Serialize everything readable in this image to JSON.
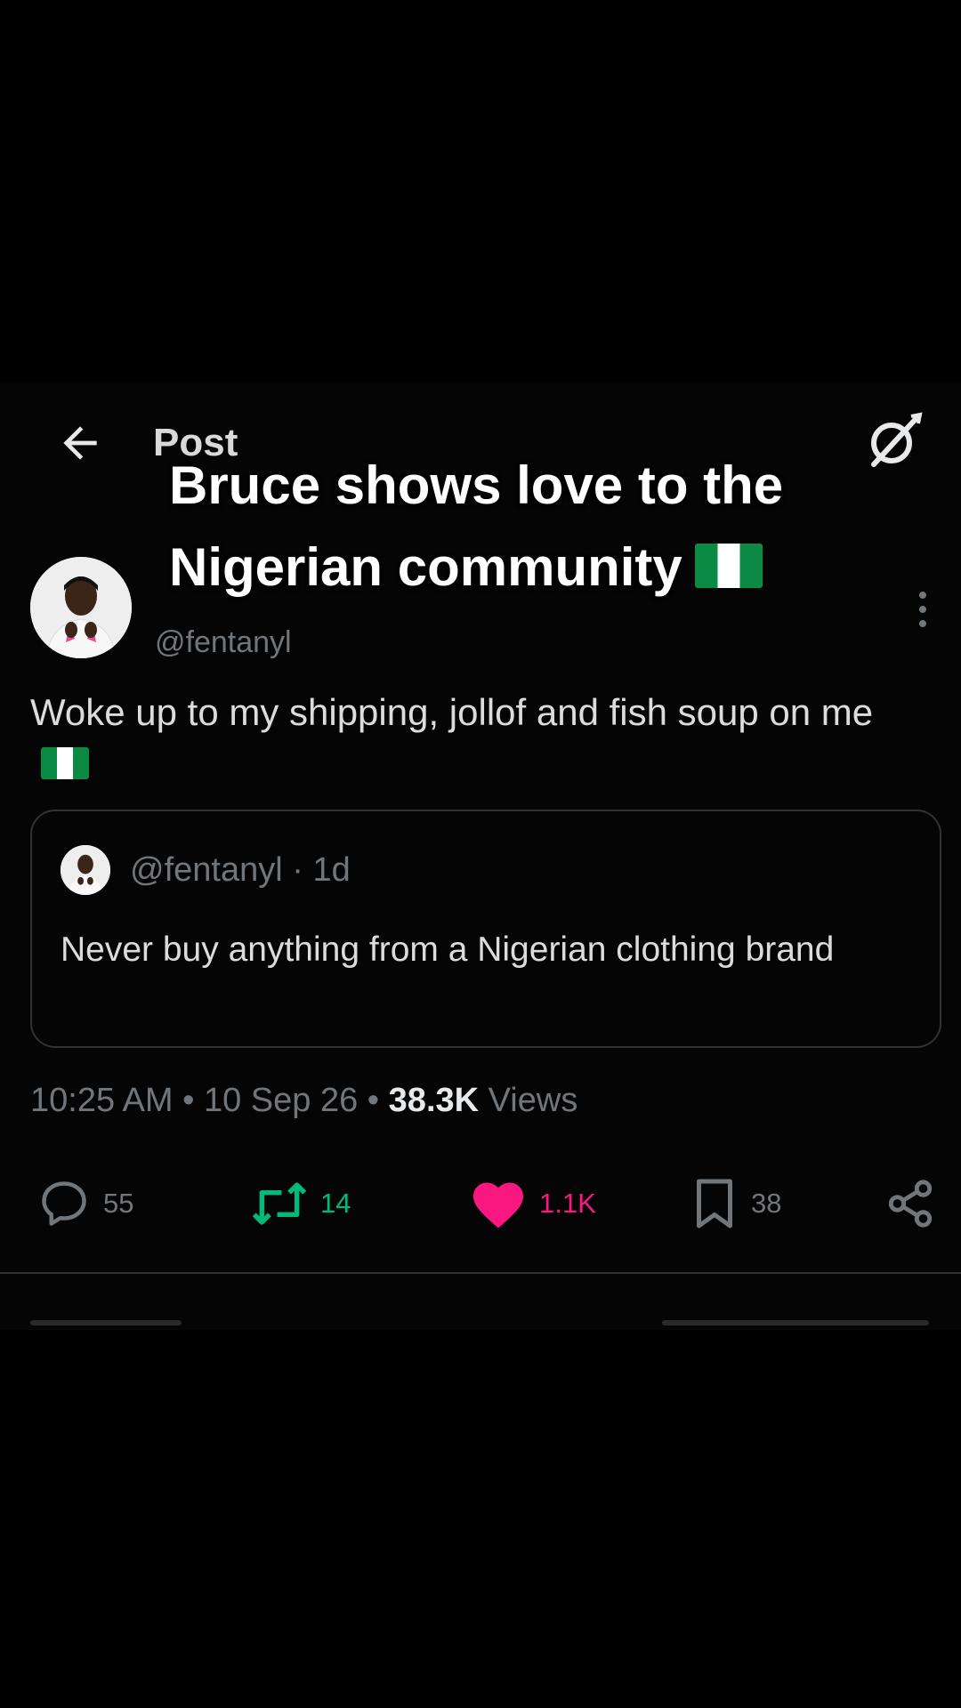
{
  "topbar": {
    "title": "Post"
  },
  "post": {
    "handle": "@fentanyl",
    "text": "Woke up to my shipping, jollof and fish soup on me",
    "flag": "nigeria-flag",
    "quote": {
      "meta": "@fentanyl · 1d",
      "text": "Never buy anything from a Nigerian clothing brand"
    },
    "meta": {
      "time_date": "10:25 AM • 10 Sep 26 •",
      "views_count": "38.3K",
      "views_label": "Views"
    },
    "actions": {
      "replies": "55",
      "reposts": "14",
      "likes": "1.1K",
      "bookmarks": "38"
    }
  },
  "overlay": {
    "line1": "Bruce shows love to the",
    "line2": "Nigerian community"
  },
  "colors": {
    "background": "#000000",
    "repost": "#00ba7c",
    "like": "#f91880",
    "muted": "#71767b",
    "flag_green": "#0a8a43"
  }
}
